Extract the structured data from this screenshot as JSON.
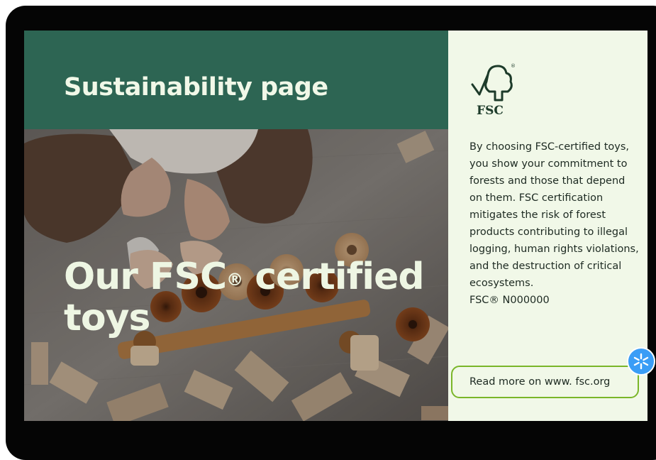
{
  "header": {
    "title": "Sustainability page"
  },
  "hero": {
    "heading_part1": "Our FSC",
    "heading_reg": "®",
    "heading_part2": " certified toys"
  },
  "sidebar": {
    "logo_text": "FSC",
    "logo_reg": "®",
    "body_text": "By choosing FSC-certified toys, you show your commitment to forests and those that depend on them. FSC certification mitigates the risk of forest products contributing to illegal logging, human rights violations, and the destruction of critical ecosystems.",
    "license_code": "FSC® N000000",
    "read_more_label": "Read more on www. fsc.org"
  },
  "colors": {
    "header_green": "#2d6553",
    "panel_bg": "#f1f8e8",
    "accent_lime": "#7ab629",
    "badge_blue": "#3a9df6",
    "device_black": "#050505"
  },
  "icons": {
    "logo": "fsc-tree-checkmark-icon",
    "badge": "sparkle-icon"
  }
}
